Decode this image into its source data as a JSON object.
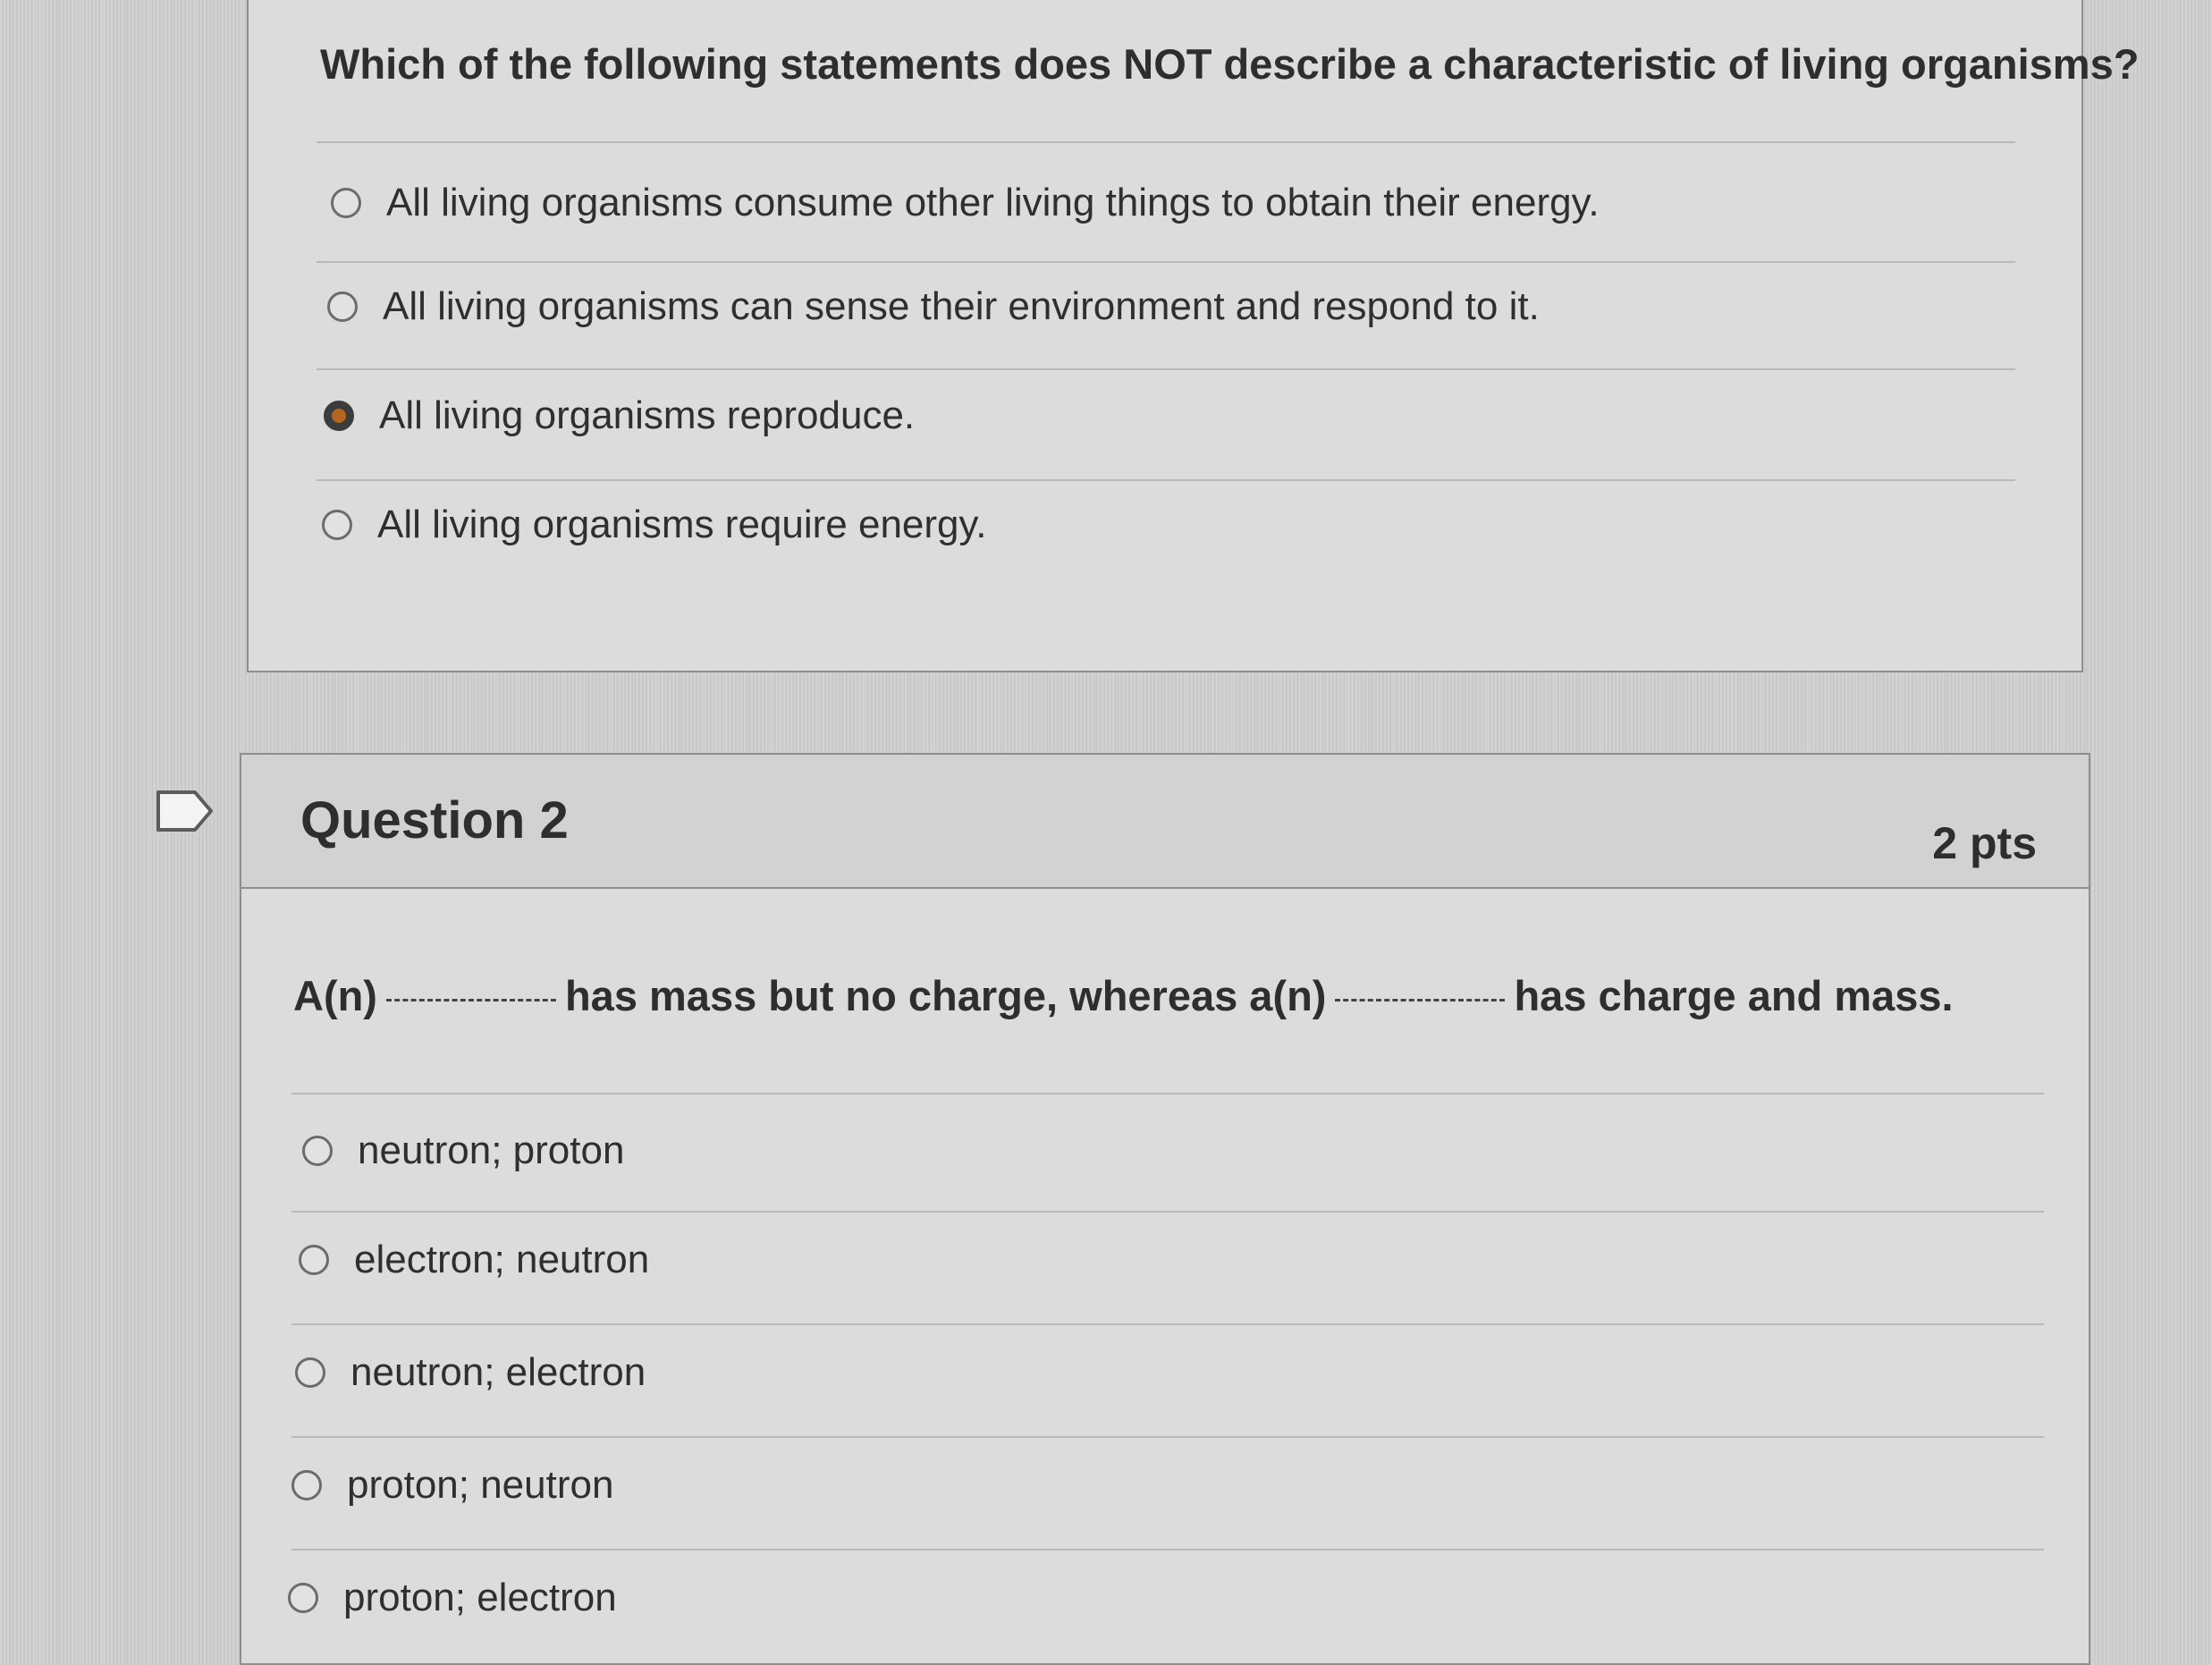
{
  "question1": {
    "prompt": "Which of the following statements does NOT describe a characteristic of living organisms?",
    "options": [
      {
        "label": "All living organisms consume other living things to obtain their energy.",
        "selected": false
      },
      {
        "label": "All living organisms can sense their environment and respond to it.",
        "selected": false
      },
      {
        "label": "All living organisms reproduce.",
        "selected": true
      },
      {
        "label": "All living organisms require energy.",
        "selected": false
      }
    ]
  },
  "question2": {
    "title": "Question 2",
    "points": "2 pts",
    "prompt_part1": "A(n)",
    "prompt_part2": "has mass but no charge, whereas a(n)",
    "prompt_part3": "has charge and mass.",
    "options": [
      {
        "label": "neutron; proton",
        "selected": false
      },
      {
        "label": "electron; neutron",
        "selected": false
      },
      {
        "label": "neutron; electron",
        "selected": false
      },
      {
        "label": "proton; neutron",
        "selected": false
      },
      {
        "label": "proton; electron",
        "selected": false
      }
    ]
  },
  "colors": {
    "selected_radio_fill": "#b5651d",
    "card_background": "#dcdcdc",
    "text": "#2e2e2e"
  },
  "icons": {
    "bookmark": "bookmark-flag-icon"
  }
}
